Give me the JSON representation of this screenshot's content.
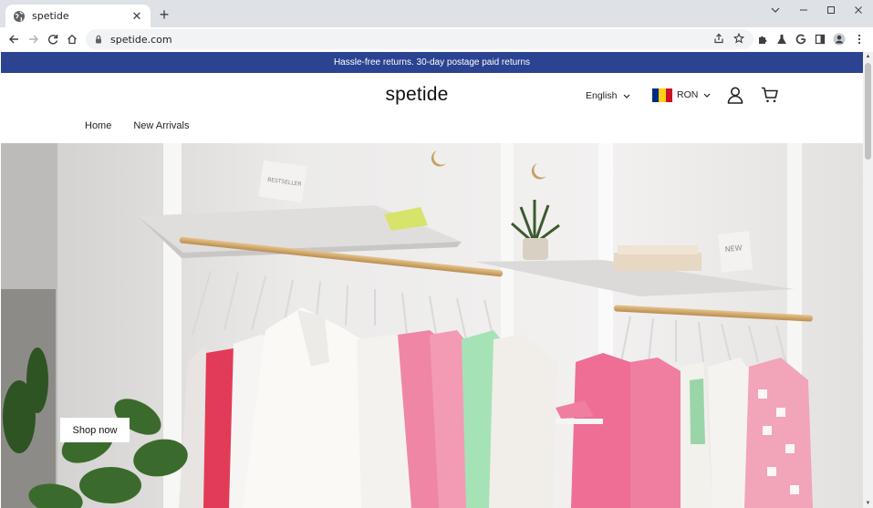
{
  "browser": {
    "tab_title": "spetide",
    "new_tab_symbol": "+",
    "close_symbol": "✕",
    "url": "spetide.com"
  },
  "announcement": "Hassle-free returns. 30-day postage paid returns",
  "header": {
    "logo": "spetide",
    "language": "English",
    "currency": "RON",
    "flag_colors": [
      "#002b7f",
      "#fcd116",
      "#ce1126"
    ]
  },
  "nav": {
    "items": [
      {
        "label": "Home"
      },
      {
        "label": "New Arrivals"
      }
    ]
  },
  "hero": {
    "button_label": "Shop now",
    "sign_bestseller": "BESTSELLER",
    "sign_new": "NEW"
  },
  "icons": {
    "account": "account-icon",
    "cart": "cart-icon",
    "language_chevron": "chevron-down-icon",
    "currency_chevron": "chevron-down-icon"
  },
  "colors": {
    "announcement_bg": "#2b4391",
    "browser_tabbar": "#dee1e6"
  }
}
